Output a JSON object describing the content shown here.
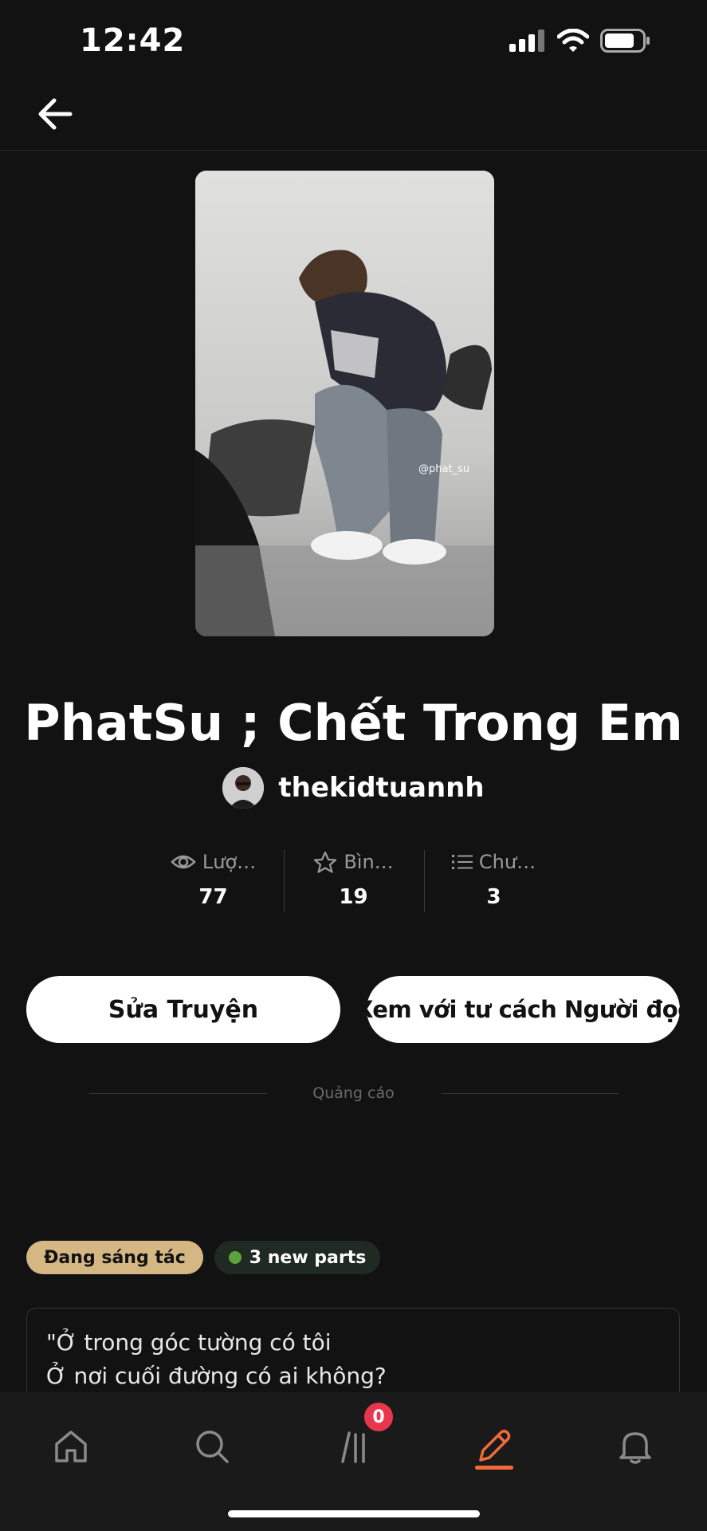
{
  "status_bar": {
    "time": "12:42"
  },
  "story": {
    "title": "PhatSu ; Chết Trong Em",
    "author": "thekidtuannh",
    "cover_watermark": "@phat_su"
  },
  "stats": [
    {
      "icon": "eye-icon",
      "label": "Lượ…",
      "value": "77"
    },
    {
      "icon": "star-icon",
      "label": "Bìn…",
      "value": "19"
    },
    {
      "icon": "list-icon",
      "label": "Chư…",
      "value": "3"
    }
  ],
  "actions": {
    "edit_label": "Sửa Truyện",
    "read_as_reader_label": "Xem với tư cách Người đọc"
  },
  "ad": {
    "label": "Quảng cáo"
  },
  "badges": {
    "status": "Đang sáng tác",
    "new_parts": "3 new parts"
  },
  "description": {
    "line1": "\"Ở trong góc tường có tôi",
    "line2": "Ở nơi cuối đường có ai không?"
  },
  "tab_bar": {
    "tabs": [
      "home",
      "search",
      "library",
      "write",
      "notifications"
    ],
    "active": "write",
    "library_badge": "0",
    "accent_color": "#f26b3a"
  }
}
